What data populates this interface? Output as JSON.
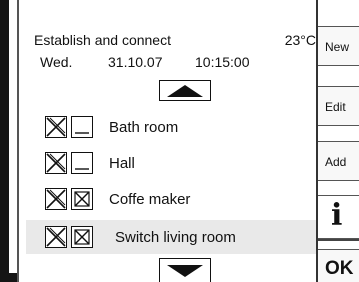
{
  "header": {
    "title": "Establish and connect",
    "temperature": "23°C",
    "day": "Wed.",
    "date": "31.10.07",
    "time": "10:15:00"
  },
  "list": {
    "items": [
      {
        "label": "Bath room",
        "check_a": "crossed",
        "check_b": "empty"
      },
      {
        "label": "Hall",
        "check_a": "crossed",
        "check_b": "empty"
      },
      {
        "label": "Coffe maker",
        "check_a": "crossed",
        "check_b": "crossed"
      },
      {
        "label": "Switch living room",
        "check_a": "crossed",
        "check_b": "crossed",
        "selected": true
      }
    ]
  },
  "sidebar": {
    "new_label": "New",
    "edit_label": "Edit",
    "add_label": "Add",
    "info_label": "i",
    "ok_label": "OK"
  },
  "icons": {
    "scroll_up": "triangle-up-icon",
    "scroll_down": "triangle-down-icon",
    "info": "info-icon"
  }
}
